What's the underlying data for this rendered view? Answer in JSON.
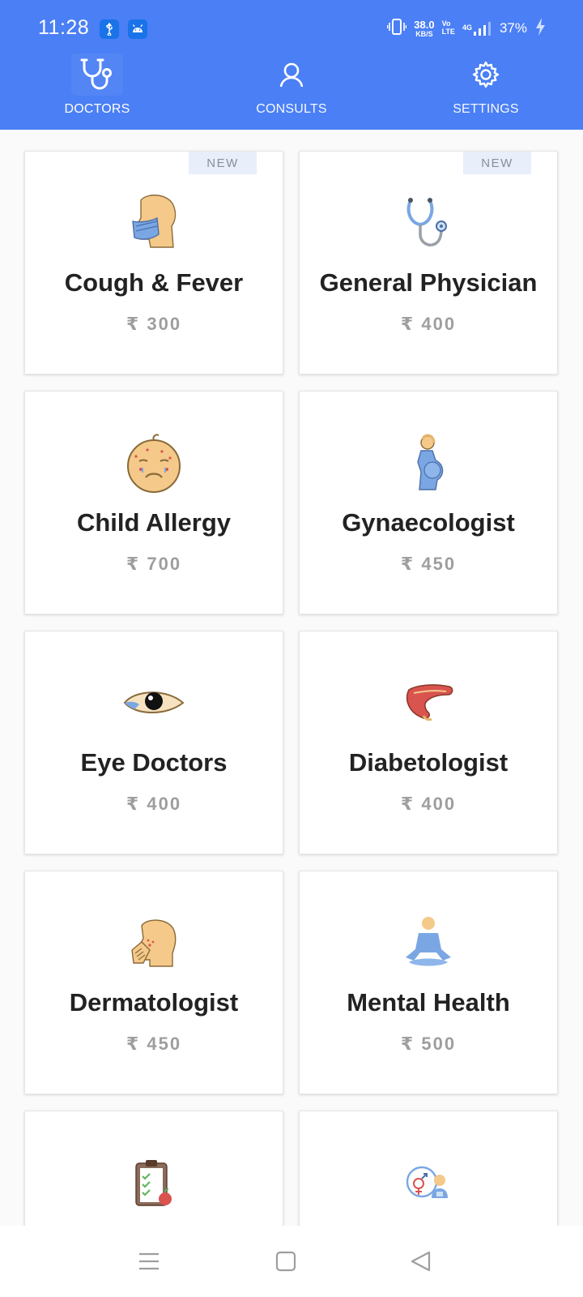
{
  "status_bar": {
    "time": "11:28",
    "net_speed": "38.0",
    "net_unit": "KB/S",
    "volte_top": "Vo",
    "volte_bottom": "LTE",
    "network": "4G",
    "battery": "37%",
    "icons": [
      "usb-icon",
      "android-icon",
      "vibrate-icon",
      "signal-icon",
      "battery-charging-icon"
    ]
  },
  "tabs": [
    {
      "label": "DOCTORS",
      "icon": "stethoscope-icon",
      "active": true
    },
    {
      "label": "CONSULTS",
      "icon": "user-icon",
      "active": false
    },
    {
      "label": "SETTINGS",
      "icon": "gear-icon",
      "active": false
    }
  ],
  "cards": [
    {
      "title": "Cough & Fever",
      "price": "₹ 300",
      "badge": "NEW",
      "icon": "masked-face-icon"
    },
    {
      "title": "General Physician",
      "price": "₹ 400",
      "badge": "NEW",
      "icon": "stethoscope-icon"
    },
    {
      "title": "Child Allergy",
      "price": "₹ 700",
      "icon": "baby-allergy-icon"
    },
    {
      "title": "Gynaecologist",
      "price": "₹ 450",
      "icon": "pregnant-woman-icon"
    },
    {
      "title": "Eye Doctors",
      "price": "₹ 400",
      "icon": "eye-icon"
    },
    {
      "title": "Diabetologist",
      "price": "₹ 400",
      "icon": "pancreas-icon"
    },
    {
      "title": "Dermatologist",
      "price": "₹ 450",
      "icon": "skin-face-icon"
    },
    {
      "title": "Mental Health",
      "price": "₹ 500",
      "icon": "meditation-icon"
    },
    {
      "icon": "diet-clipboard-icon"
    },
    {
      "icon": "sexology-icon"
    }
  ],
  "nav": [
    "menu-icon",
    "home-square-icon",
    "back-triangle-icon"
  ],
  "colors": {
    "header": "#4a7ff5",
    "badge_bg": "#e9eefb",
    "price": "#9e9e9e",
    "title": "#222222"
  }
}
